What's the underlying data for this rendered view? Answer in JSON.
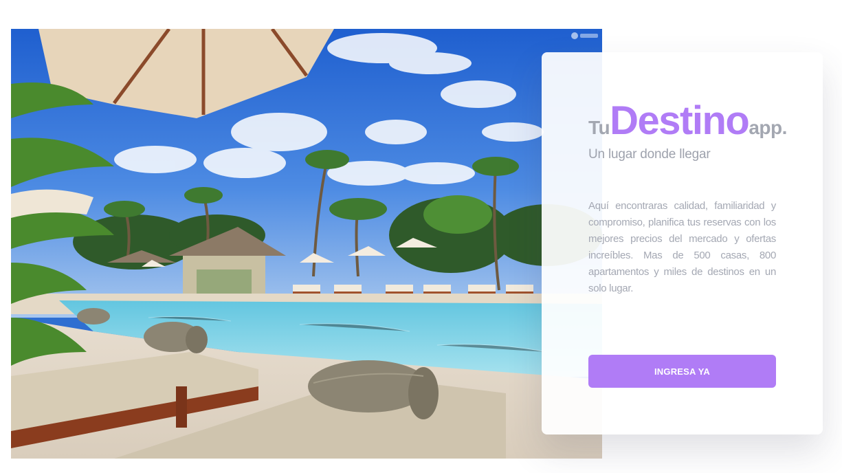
{
  "brand": {
    "prefix": "Tu",
    "name": "Destino",
    "suffix": "app."
  },
  "tagline": "Un lugar donde llegar",
  "description": "Aquí encontraras calidad, familiaridad y compromiso, planifica tus reservas con los mejores precios del mercado y ofertas increíbles. Mas de 500 casas, 800 apartamentos y miles de destinos en un solo lugar.",
  "cta": {
    "label": "INGRESA YA"
  },
  "hero": {
    "image": "resort-pool-photo"
  },
  "colors": {
    "accent": "#b07cf6",
    "muted_text": "#a3a7b1",
    "background": "#ffffff"
  }
}
